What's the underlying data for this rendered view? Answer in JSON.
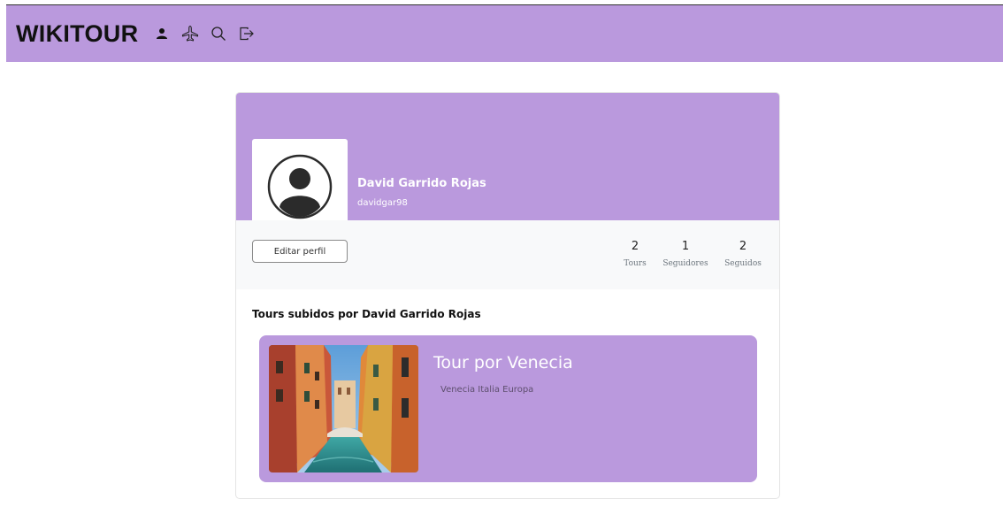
{
  "navbar": {
    "brand": "WIKITOUR",
    "icons": [
      "person-icon",
      "plane-icon",
      "search-icon",
      "logout-icon"
    ]
  },
  "profile": {
    "name": "David Garrido Rojas",
    "username": "davidgar98",
    "edit_label": "Editar perfil",
    "stats": [
      {
        "value": "2",
        "label": "Tours"
      },
      {
        "value": "1",
        "label": "Seguidores"
      },
      {
        "value": "2",
        "label": "Seguidos"
      }
    ]
  },
  "tours_section": {
    "title": "Tours subidos por David Garrido Rojas",
    "items": [
      {
        "title": "Tour por Venecia",
        "location": "Venecia Italia Europa",
        "image": "venice-canal-photo"
      }
    ]
  },
  "colors": {
    "accent": "#ba99dd",
    "light_bg": "#f8f9fa"
  }
}
